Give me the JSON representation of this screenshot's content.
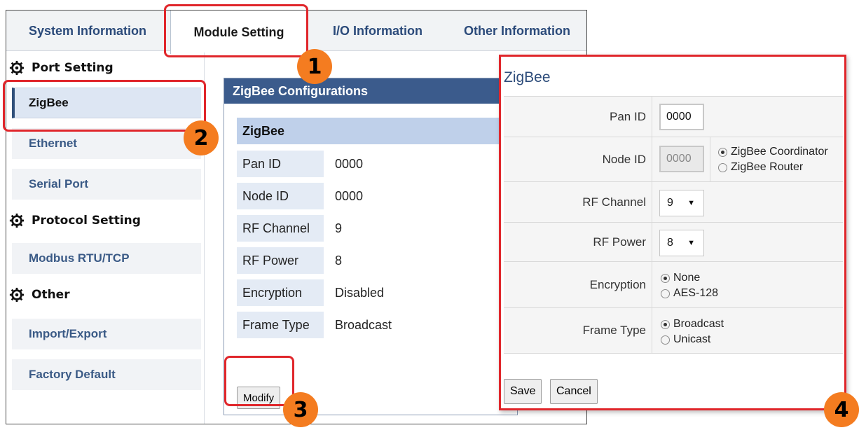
{
  "tabs": [
    {
      "label": "System Information"
    },
    {
      "label": "Module Setting"
    },
    {
      "label": "I/O Information"
    },
    {
      "label": "Other Information"
    }
  ],
  "sidebar": {
    "port_setting": "Port Setting",
    "protocol_setting": "Protocol Setting",
    "other": "Other",
    "items": [
      {
        "label": "ZigBee"
      },
      {
        "label": "Ethernet"
      },
      {
        "label": "Serial Port"
      },
      {
        "label": "Modbus RTU/TCP"
      },
      {
        "label": "Import/Export"
      },
      {
        "label": "Factory Default"
      }
    ]
  },
  "config": {
    "title": "ZigBee Configurations",
    "subhead": "ZigBee",
    "rows": [
      {
        "label": "Pan ID",
        "value": "0000"
      },
      {
        "label": "Node ID",
        "value": "0000"
      },
      {
        "label": "RF Channel",
        "value": "9"
      },
      {
        "label": "RF Power",
        "value": "8"
      },
      {
        "label": "Encryption",
        "value": "Disabled"
      },
      {
        "label": "Frame Type",
        "value": "Broadcast"
      }
    ],
    "modify_label": "Modify"
  },
  "dialog": {
    "title": "ZigBee",
    "pan_id_label": "Pan ID",
    "pan_id_value": "0000",
    "node_id_label": "Node ID",
    "node_id_value": "0000",
    "node_role_options": [
      "ZigBee Coordinator",
      "ZigBee Router"
    ],
    "rf_channel_label": "RF Channel",
    "rf_channel_value": "9",
    "rf_power_label": "RF Power",
    "rf_power_value": "8",
    "encryption_label": "Encryption",
    "encryption_options": [
      "None",
      "AES-128"
    ],
    "frame_type_label": "Frame Type",
    "frame_type_options": [
      "Broadcast",
      "Unicast"
    ],
    "save_label": "Save",
    "cancel_label": "Cancel"
  },
  "callouts": [
    "1",
    "2",
    "3",
    "4"
  ],
  "colors": {
    "callout_red": "#e0262b",
    "badge_orange": "#f47c20",
    "header_blue": "#3b5b8c",
    "subhead_blue": "#bfd0ea"
  },
  "icons": [
    "gear-icon",
    "caret-down-icon"
  ]
}
